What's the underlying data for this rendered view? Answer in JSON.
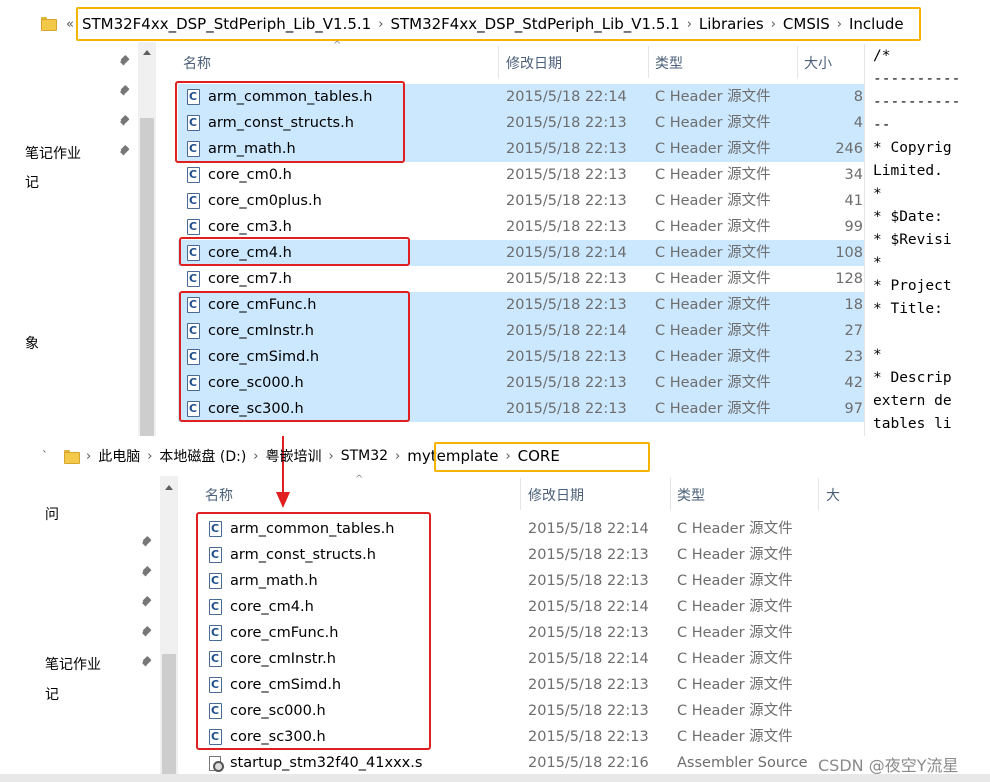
{
  "top_window": {
    "breadcrumb": [
      "«",
      "STM32F4xx_DSP_StdPeriph_Lib_V1.5.1",
      "STM32F4xx_DSP_StdPeriph_Lib_V1.5.1",
      "Libraries",
      "CMSIS",
      "Include"
    ],
    "nav_items": [
      "笔记作业",
      "记",
      "象"
    ],
    "columns": [
      "名称",
      "修改日期",
      "类型",
      "大小"
    ],
    "files": [
      {
        "name": "arm_common_tables.h",
        "date": "2015/5/18 22:14",
        "type": "C Header 源文件",
        "size": "8"
      },
      {
        "name": "arm_const_structs.h",
        "date": "2015/5/18 22:13",
        "type": "C Header 源文件",
        "size": "4"
      },
      {
        "name": "arm_math.h",
        "date": "2015/5/18 22:13",
        "type": "C Header 源文件",
        "size": "246"
      },
      {
        "name": "core_cm0.h",
        "date": "2015/5/18 22:13",
        "type": "C Header 源文件",
        "size": "34"
      },
      {
        "name": "core_cm0plus.h",
        "date": "2015/5/18 22:13",
        "type": "C Header 源文件",
        "size": "41"
      },
      {
        "name": "core_cm3.h",
        "date": "2015/5/18 22:13",
        "type": "C Header 源文件",
        "size": "99"
      },
      {
        "name": "core_cm4.h",
        "date": "2015/5/18 22:14",
        "type": "C Header 源文件",
        "size": "108"
      },
      {
        "name": "core_cm7.h",
        "date": "2015/5/18 22:13",
        "type": "C Header 源文件",
        "size": "128"
      },
      {
        "name": "core_cmFunc.h",
        "date": "2015/5/18 22:13",
        "type": "C Header 源文件",
        "size": "18"
      },
      {
        "name": "core_cmInstr.h",
        "date": "2015/5/18 22:14",
        "type": "C Header 源文件",
        "size": "27"
      },
      {
        "name": "core_cmSimd.h",
        "date": "2015/5/18 22:13",
        "type": "C Header 源文件",
        "size": "23"
      },
      {
        "name": "core_sc000.h",
        "date": "2015/5/18 22:13",
        "type": "C Header 源文件",
        "size": "42"
      },
      {
        "name": "core_sc300.h",
        "date": "2015/5/18 22:13",
        "type": "C Header 源文件",
        "size": "97"
      }
    ],
    "preview_lines": [
      "/*",
      "----------",
      "----------",
      "--",
      "* Copyrig",
      "Limited.",
      "*",
      "* $Date:",
      "* $Revisi",
      "*",
      "* Project",
      "* Title:",
      "",
      "*",
      "* Descrip",
      "extern de",
      "tables li"
    ]
  },
  "bottom_window": {
    "breadcrumb": [
      "此电脑",
      "本地磁盘 (D:)",
      "粤嵌培训",
      "STM32",
      "mytemplate",
      "CORE"
    ],
    "nav_items": [
      "问",
      "笔记作业",
      "记"
    ],
    "columns": [
      "名称",
      "修改日期",
      "类型",
      "大"
    ],
    "files": [
      {
        "name": "arm_common_tables.h",
        "date": "2015/5/18 22:14",
        "type": "C Header 源文件"
      },
      {
        "name": "arm_const_structs.h",
        "date": "2015/5/18 22:13",
        "type": "C Header 源文件"
      },
      {
        "name": "arm_math.h",
        "date": "2015/5/18 22:13",
        "type": "C Header 源文件"
      },
      {
        "name": "core_cm4.h",
        "date": "2015/5/18 22:14",
        "type": "C Header 源文件"
      },
      {
        "name": "core_cmFunc.h",
        "date": "2015/5/18 22:13",
        "type": "C Header 源文件"
      },
      {
        "name": "core_cmInstr.h",
        "date": "2015/5/18 22:14",
        "type": "C Header 源文件"
      },
      {
        "name": "core_cmSimd.h",
        "date": "2015/5/18 22:13",
        "type": "C Header 源文件"
      },
      {
        "name": "core_sc000.h",
        "date": "2015/5/18 22:13",
        "type": "C Header 源文件"
      },
      {
        "name": "core_sc300.h",
        "date": "2015/5/18 22:13",
        "type": "C Header 源文件"
      },
      {
        "name": "startup_stm32f40_41xxx.s",
        "date": "2015/5/18 22:16",
        "type": "Assembler Source"
      }
    ]
  },
  "watermark": "CSDN @夜空Y流星",
  "colors": {
    "selection": "#cce8ff",
    "highlight_box": "#f5b400",
    "annotation_red": "#e02020"
  }
}
